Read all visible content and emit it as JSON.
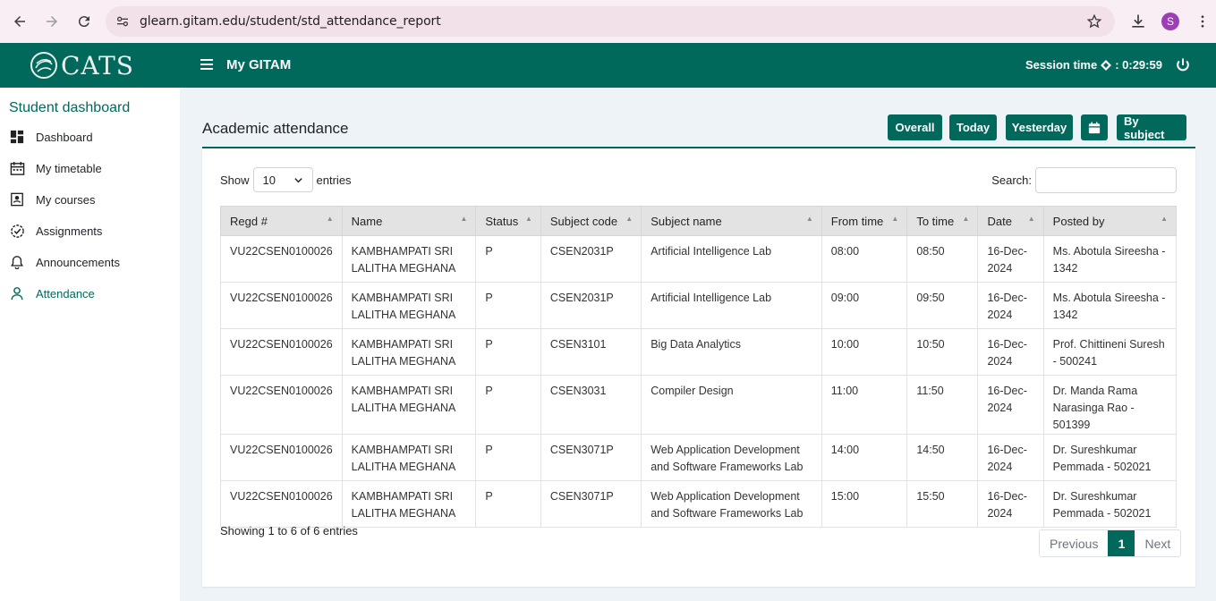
{
  "browser": {
    "url": "glearn.gitam.edu/student/std_attendance_report",
    "profile_initial": "S"
  },
  "header": {
    "logo_text": "CATS",
    "app_title": "My GITAM",
    "session_label": "Session time",
    "session_value": ": 0:29:59"
  },
  "sidebar": {
    "title": "Student dashboard",
    "items": [
      {
        "label": "Dashboard",
        "icon": "dashboard-icon"
      },
      {
        "label": "My timetable",
        "icon": "calendar-icon"
      },
      {
        "label": "My courses",
        "icon": "courses-icon"
      },
      {
        "label": "Assignments",
        "icon": "assignments-icon"
      },
      {
        "label": "Announcements",
        "icon": "bell-icon"
      },
      {
        "label": "Attendance",
        "icon": "person-icon",
        "active": true
      }
    ]
  },
  "main": {
    "title": "Academic attendance",
    "buttons": {
      "overall": "Overall",
      "today": "Today",
      "yesterday": "Yesterday",
      "by_subject": "By subject"
    },
    "show_label": "Show",
    "entries_label": "entries",
    "page_length": "10",
    "search_label": "Search:",
    "search_value": "",
    "columns": [
      "Regd #",
      "Name",
      "Status",
      "Subject code",
      "Subject name",
      "From time",
      "To time",
      "Date",
      "Posted by"
    ],
    "rows": [
      [
        "VU22CSEN0100026",
        "KAMBHAMPATI SRI LALITHA MEGHANA",
        "P",
        "CSEN2031P",
        "Artificial Intelligence Lab",
        "08:00",
        "08:50",
        "16-Dec-2024",
        "Ms. Abotula Sireesha - 1342"
      ],
      [
        "VU22CSEN0100026",
        "KAMBHAMPATI SRI LALITHA MEGHANA",
        "P",
        "CSEN2031P",
        "Artificial Intelligence Lab",
        "09:00",
        "09:50",
        "16-Dec-2024",
        "Ms. Abotula Sireesha - 1342"
      ],
      [
        "VU22CSEN0100026",
        "KAMBHAMPATI SRI LALITHA MEGHANA",
        "P",
        "CSEN3101",
        "Big Data Analytics",
        "10:00",
        "10:50",
        "16-Dec-2024",
        "Prof. Chittineni Suresh - 500241"
      ],
      [
        "VU22CSEN0100026",
        "KAMBHAMPATI SRI LALITHA MEGHANA",
        "P",
        "CSEN3031",
        "Compiler Design",
        "11:00",
        "11:50",
        "16-Dec-2024",
        "Dr. Manda Rama Narasinga Rao - 501399"
      ],
      [
        "VU22CSEN0100026",
        "KAMBHAMPATI SRI LALITHA MEGHANA",
        "P",
        "CSEN3071P",
        "Web Application Development and Software Frameworks Lab",
        "14:00",
        "14:50",
        "16-Dec-2024",
        "Dr. Sureshkumar Pemmada - 502021"
      ],
      [
        "VU22CSEN0100026",
        "KAMBHAMPATI SRI LALITHA MEGHANA",
        "P",
        "CSEN3071P",
        "Web Application Development and Software Frameworks Lab",
        "15:00",
        "15:50",
        "16-Dec-2024",
        "Dr. Sureshkumar Pemmada - 502021"
      ]
    ],
    "info_text": "Showing 1 to 6 of 6 entries",
    "pagination": {
      "previous": "Previous",
      "current": "1",
      "next": "Next"
    }
  },
  "colors": {
    "accent": "#00695c",
    "page_bg": "#eef3f7"
  }
}
